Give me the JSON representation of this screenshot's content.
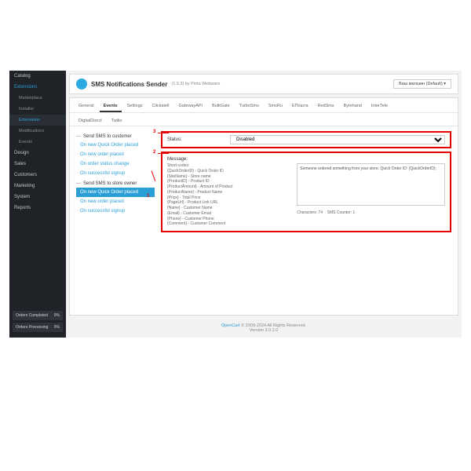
{
  "sidebar": {
    "items": [
      "Catalog",
      "Extensions",
      "Design",
      "Sales",
      "Customers",
      "Marketing",
      "System",
      "Reports"
    ],
    "subs": [
      "Marketplace",
      "Installer",
      "Extensions",
      "Modifications",
      "Events"
    ],
    "activeIndex": 1,
    "activeSub": 2,
    "bottom": [
      {
        "label": "Orders Completed",
        "val": "0%"
      },
      {
        "label": "Orders Processing",
        "val": "0%"
      }
    ]
  },
  "header": {
    "title": "SMS Notifications Sender",
    "version": "(1.9.3) by Pinta Webware",
    "store_label": "Ваш магазин (Default)"
  },
  "tabs": [
    "General",
    "Events",
    "Settings",
    "Clickatell",
    "GatewayAPI",
    "BulkGate",
    "TurboSms",
    "SmsRu",
    "EПошта",
    "RedSms",
    "Bytehand",
    "InterTele",
    "DigitalDirect",
    "Twilio"
  ],
  "activeTab": 1,
  "events": {
    "sect1": "Send SMS to customer",
    "c": [
      "On new Quick Order placed",
      "On new order placed",
      "On order status change",
      "On successful signup"
    ],
    "sect2": "Send SMS to store owner",
    "o": [
      "On new Quick Order placed",
      "On new order placed",
      "On successful signup"
    ],
    "selected": "o0"
  },
  "form": {
    "status_label": "Status:",
    "status_value": "Disabled",
    "msg_label": "Message:",
    "shortcodes_head": "Short-codes:",
    "shortcodes": "{QuickOrderID} - Quick Order ID\n{SiteName} - Store name\n{ProductID} - Product ID\n{ProductAmount} - Amount of Product\n{ProductName} - Product Name\n{Price} - Total Price\n{PageUrl} - Product Link URL\n{Name} - Customer Name\n{Email} - Customer Email\n{Phone} - Customer Phone\n{Comment} - Customer Comment",
    "textarea": "Someone ordered something from your store. Quick Order ID: {QuickOrderID};",
    "char_label": "Characters:",
    "char_val": "74",
    "sms_label": "SMS Counter:",
    "sms_val": "1"
  },
  "footer": {
    "brand": "OpenCart",
    "copy": " © 2009-2024 All Rights Reserved.",
    "ver": "Version 3.0.2.0"
  },
  "annot": {
    "n1": "1",
    "n2": "2",
    "n3": "3"
  }
}
